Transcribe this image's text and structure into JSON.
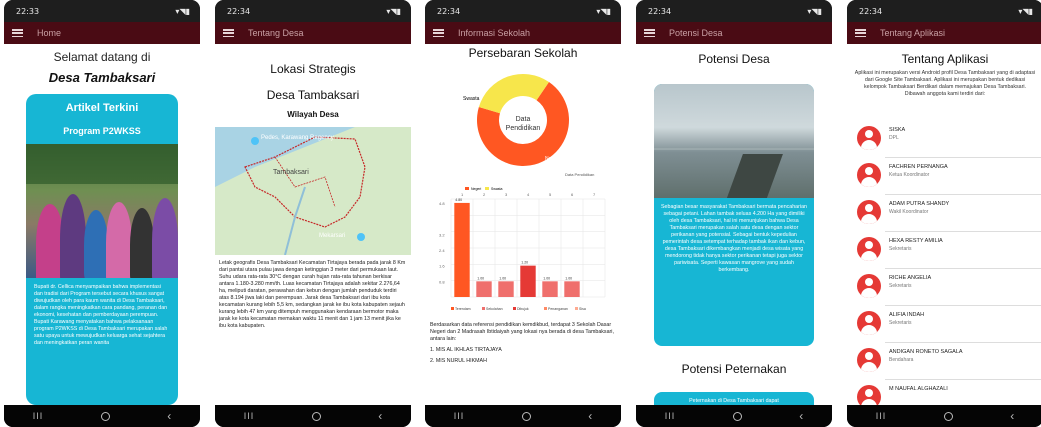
{
  "colors": {
    "appbar": "#4a0b14",
    "accent_cyan": "#17b6d4",
    "chart_orange": "#ff5722",
    "chart_yellow": "#f7e64b",
    "avatar_red": "#e53935"
  },
  "status_times": [
    "22:33",
    "22:34",
    "22:34",
    "22:34",
    "22:34"
  ],
  "nav": {
    "back": "‹",
    "home": "○",
    "recent": "III"
  },
  "phone1": {
    "appbar_title": "Home",
    "welcome": "Selamat datang di",
    "village": "Desa Tambaksari",
    "card_title": "Artikel Terkini",
    "card_sub": "Program P2WKSS",
    "article": "Bupati dr. Cellica menyampaikan bahwa implementasi dan tradisi dari Program tersebut secara khusus sangat diwujudkan oleh para kaum wanita di Desa Tambaksari, dalam rangka meningkatkan cara pandang, peranan dan ekonomi, kesehatan dan pemberdayaan perempuan. Bupati Karawang menyatakan bahwa pelaksanaan program P2WKSS di Desa Tambaksari merupakan salah satu upaya untuk mewujudkan keluarga sehat sejahtera dan meningkatkan peran wanita"
  },
  "phone2": {
    "appbar_title": "Tentang Desa",
    "h1": "Lokasi Strategis",
    "h2": "Desa Tambaksari",
    "h3": "Wilayah Desa",
    "map_labels": [
      "Pedes, Karawang Regency",
      "Tambaksari",
      "Mekarsari"
    ],
    "text": "Letak geografis Desa Tambaksari Kecamatan Tirtajaya berada pada jarak 8 Km dari pantai utara pulau jawa dengan ketinggian 3 meter dari permukaan laut. Suhu udara rata-rata 30°C dengan curah hujan rata-rata tahunan berkisar antara 1.180-3.280 mm/th. Luas kecamatan Tirtajaya adalah sekitar 2.276,64 ha, meliputi daratan, perawahan dan kebun dengan jumlah penduduk terdiri atas 8.194 jiwa laki dan perempuan. Jarak desa Tambaksari dari ibu kota kecamatan kurang lebih 5,5 km, sedangkan jarak ke ibu kota kabupaten sejauh kurang lebih 47 km yang ditempuh menggunakan kendaraan bermotor maka jarak ke kota kecamatan memakan waktu 11 menit dan 1 jam 13 menit jika ke ibu kota kabupaten."
  },
  "phone3": {
    "appbar_title": "Informasi Sekolah",
    "title": "Persebaran Sekolah",
    "donut_center": [
      "Data",
      "Pendidikan"
    ],
    "donut_labels": [
      "Swasta",
      "Negeri"
    ],
    "donut_legend": "Data Pendidikan",
    "text": "Berdasarkan data referensi pendidikan kemdikbud, terdapat 3 Sekolah Dasar Negeri dan 2 Madrasah Ibtidaiyah yang lokasi nya berada di desa Tambaksari, antara lain:",
    "list": [
      "1. MIS AL IKHLAS TIRTAJAYA",
      "2. MIS NURUL HIKMAH"
    ]
  },
  "chart_data": [
    {
      "type": "pie",
      "title": "Data Pendidikan",
      "categories": [
        "Negeri",
        "Swasta"
      ],
      "values": [
        0.7,
        0.3
      ],
      "legend": "top"
    },
    {
      "type": "bar",
      "title": "",
      "categories": [
        "Terendam",
        "Sekolahan",
        "Dibujuk",
        "Penanganan",
        "Sisa"
      ],
      "values": [
        4.8,
        0.8,
        0.8,
        1.6,
        0.8,
        0.8
      ],
      "data_labels": [
        "4.80",
        "1.00",
        "1.00",
        "1.20",
        "1.00",
        "1.00"
      ],
      "x": [
        "1",
        "2",
        "3",
        "4",
        "5",
        "6",
        "7"
      ],
      "yticks": [
        "4.8",
        "3.2",
        "2.4",
        "1.6",
        "0.8"
      ],
      "ylim": [
        0,
        5
      ],
      "grid": true,
      "legend": "bottom"
    }
  ],
  "phone4": {
    "appbar_title": "Potensi Desa",
    "title": "Potensi Desa",
    "text": "Sebagian besar masyarakat Tambaksari bermata pencaharian sebagai petani. Lahan tambak seluas 4.200 Ha yang dimiliki oleh desa Tambaksari, hal ini menunjukan bahwa Desa Tambaksari merupakan salah satu desa dengan sektor perikanan yang potensial. Sebagai bentuk kepedulian pemerintah desa setempat terhadap tambak ikan dan kebun, desa Tambaksari dikembangkan menjadi desa wisata yang mendorong tidak hanya sektor perikanan tetapi juga sektor pariwisata. Seperti kawasan mangrove yang sudah berkembang.",
    "subtitle": "Potensi Peternakan",
    "text2": "Peternakan di Desa Tambaksari dapat"
  },
  "phone5": {
    "appbar_title": "Tentang Aplikasi",
    "title": "Tentang Aplikasi",
    "desc": "Aplikasi ini merupakan versi Android profil Desa Tambaksari yang di adaptasi dari Google Site Tambaksari. Aplikasi ini merupakan bentuk dedikasi kelompok Tambaksari Berdikari dalam memajukan Desa Tambaksari. Dibawah anggota kami terdiri dari:",
    "members": [
      {
        "name": "SISKA",
        "role": "DPL"
      },
      {
        "name": "FACHREN PERNANGA",
        "role": "Ketua Koordinator"
      },
      {
        "name": "ADAM PUTRA SHANDY",
        "role": "Wakil Koordinator"
      },
      {
        "name": "HEXA RESTY AMILIA",
        "role": "Sekretaris"
      },
      {
        "name": "RICHE ANGELIA",
        "role": "Sekretaris"
      },
      {
        "name": "ALIFIA INDAH",
        "role": "Sekretaris"
      },
      {
        "name": "ANDIGAN RONETO SAGALA",
        "role": "Bendahara"
      },
      {
        "name": "M NAUFAL ALGHAZALI",
        "role": ""
      }
    ]
  }
}
